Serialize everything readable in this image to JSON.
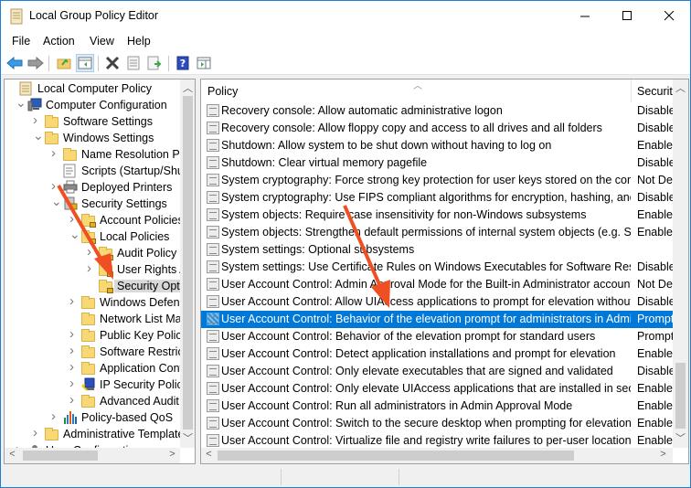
{
  "window": {
    "title": "Local Group Policy Editor",
    "controls": {
      "minimize": "minimize",
      "maximize": "maximize",
      "close": "close"
    }
  },
  "menu": [
    "File",
    "Action",
    "View",
    "Help"
  ],
  "toolbar": {
    "buttons": [
      "back",
      "forward",
      "up-one-level",
      "show-hide-console-tree",
      "delete",
      "properties",
      "export-list",
      "help",
      "show-hide-action-pane"
    ]
  },
  "tree": {
    "items": [
      {
        "label": "Local Computer Policy",
        "icon": "policy-scroll",
        "expander": "none"
      },
      {
        "label": "Computer Configuration",
        "icon": "computer",
        "expander": "expanded"
      },
      {
        "label": "Software Settings",
        "icon": "folder",
        "expander": "collapsed"
      },
      {
        "label": "Windows Settings",
        "icon": "folder",
        "expander": "expanded"
      },
      {
        "label": "Name Resolution Pol",
        "icon": "folder",
        "expander": "collapsed"
      },
      {
        "label": "Scripts (Startup/Shut",
        "icon": "script",
        "expander": "none"
      },
      {
        "label": "Deployed Printers",
        "icon": "printer",
        "expander": "collapsed"
      },
      {
        "label": "Security Settings",
        "icon": "security",
        "expander": "expanded"
      },
      {
        "label": "Account Policies",
        "icon": "locked-folder",
        "expander": "collapsed"
      },
      {
        "label": "Local Policies",
        "icon": "locked-folder",
        "expander": "expanded"
      },
      {
        "label": "Audit Policy",
        "icon": "locked-folder",
        "expander": "collapsed"
      },
      {
        "label": "User Rights As",
        "icon": "locked-folder",
        "expander": "collapsed"
      },
      {
        "label": "Security Optic",
        "icon": "locked-folder",
        "expander": "none",
        "selected": true
      },
      {
        "label": "Windows Defend",
        "icon": "folder",
        "expander": "collapsed"
      },
      {
        "label": "Network List Mar",
        "icon": "folder",
        "expander": "none"
      },
      {
        "label": "Public Key Policie",
        "icon": "folder",
        "expander": "collapsed"
      },
      {
        "label": "Software Restricti",
        "icon": "folder",
        "expander": "collapsed"
      },
      {
        "label": "Application Cont",
        "icon": "folder",
        "expander": "collapsed"
      },
      {
        "label": "IP Security Policie",
        "icon": "ip-security",
        "expander": "collapsed"
      },
      {
        "label": "Advanced Audit F",
        "icon": "folder",
        "expander": "collapsed"
      },
      {
        "label": "Policy-based QoS",
        "icon": "qos-chart",
        "expander": "collapsed"
      },
      {
        "label": "Administrative Template",
        "icon": "folder",
        "expander": "collapsed"
      },
      {
        "label": "User Configuration",
        "icon": "user",
        "expander": "collapsed"
      }
    ]
  },
  "list": {
    "columns": {
      "policy": "Policy",
      "setting": "Security Setting"
    },
    "rows": [
      {
        "policy": "Recovery console: Allow automatic administrative logon",
        "setting": "Disabled"
      },
      {
        "policy": "Recovery console: Allow floppy copy and access to all drives and all folders",
        "setting": "Disabled"
      },
      {
        "policy": "Shutdown: Allow system to be shut down without having to log on",
        "setting": "Enabled"
      },
      {
        "policy": "Shutdown: Clear virtual memory pagefile",
        "setting": "Disabled"
      },
      {
        "policy": "System cryptography: Force strong key protection for user keys stored on the com...",
        "setting": "Not Defined"
      },
      {
        "policy": "System cryptography: Use FIPS compliant algorithms for encryption, hashing, and ...",
        "setting": "Disabled"
      },
      {
        "policy": "System objects: Require case insensitivity for non-Windows subsystems",
        "setting": "Enabled"
      },
      {
        "policy": "System objects: Strengthen default permissions of internal system objects (e.g. Sy...",
        "setting": "Enabled"
      },
      {
        "policy": "System settings: Optional subsystems",
        "setting": ""
      },
      {
        "policy": "System settings: Use Certificate Rules on Windows Executables for Software Restrict...",
        "setting": "Disabled"
      },
      {
        "policy": "User Account Control: Admin Approval Mode for the Built-in Administrator account",
        "setting": "Not Defined"
      },
      {
        "policy": "User Account Control: Allow UIAccess applications to prompt for elevation without...",
        "setting": "Disabled"
      },
      {
        "policy": "User Account Control: Behavior of the elevation prompt for administrators in Admi...",
        "setting": "Prompt",
        "selected": true
      },
      {
        "policy": "User Account Control: Behavior of the elevation prompt for standard users",
        "setting": "Prompt"
      },
      {
        "policy": "User Account Control: Detect application installations and prompt for elevation",
        "setting": "Enabled"
      },
      {
        "policy": "User Account Control: Only elevate executables that are signed and validated",
        "setting": "Disabled"
      },
      {
        "policy": "User Account Control: Only elevate UIAccess applications that are installed in secur...",
        "setting": "Enabled"
      },
      {
        "policy": "User Account Control: Run all administrators in Admin Approval Mode",
        "setting": "Enabled"
      },
      {
        "policy": "User Account Control: Switch to the secure desktop when prompting for elevation",
        "setting": "Enabled"
      },
      {
        "policy": "User Account Control: Virtualize file and registry write failures to per-user locations",
        "setting": "Enabled"
      }
    ]
  },
  "scrollbars": {
    "tree_vertical_position": 0.5,
    "list_vertical_position": 0.85,
    "list_horizontal_position": 0.0
  },
  "annotation": {
    "arrow_color": "#f04e23",
    "arrows": [
      "points-to-security-options",
      "points-to-selected-policy"
    ]
  },
  "colors": {
    "selection": "#0078d7",
    "tree_selection": "#d9d9d9",
    "window_border": "#1c7ed6"
  }
}
